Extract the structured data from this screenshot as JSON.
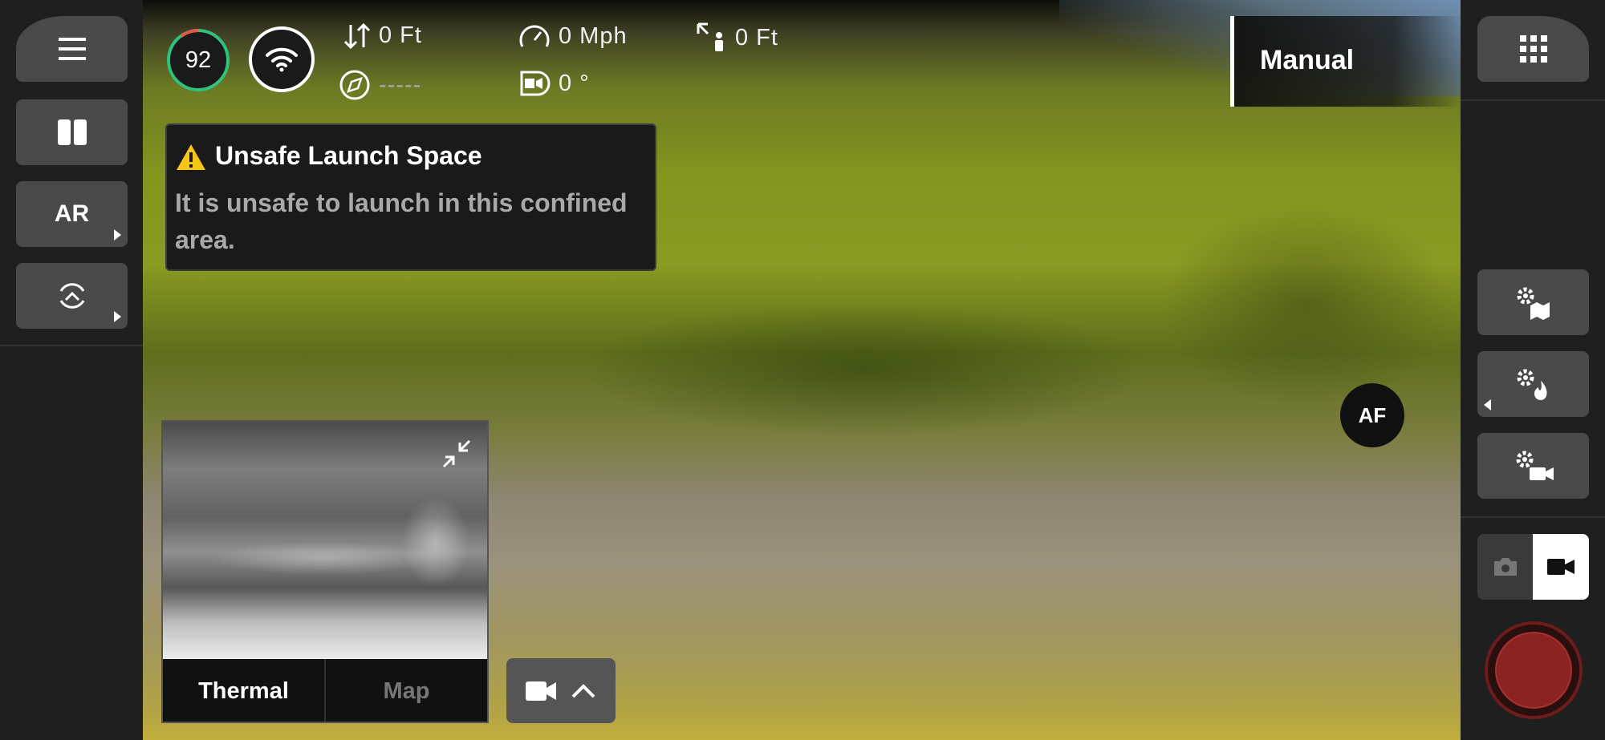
{
  "battery": {
    "percent": "92",
    "level": 0.92
  },
  "telemetry": {
    "altitude": "0 Ft",
    "speed": "0 Mph",
    "distance": "0 Ft",
    "heading": "-----",
    "gimbal": "0 °"
  },
  "flight_mode": "Manual",
  "left_rail": {
    "ar_label": "AR"
  },
  "alert": {
    "title": "Unsafe Launch Space",
    "body": "It is unsafe to launch in this confined area."
  },
  "pip": {
    "tab_active": "Thermal",
    "tab_inactive": "Map"
  },
  "af_label": "AF",
  "colors": {
    "battery_ring": "#2ec27e",
    "battery_low": "#e05a47",
    "record": "#8b2323",
    "warning": "#f5c518"
  }
}
